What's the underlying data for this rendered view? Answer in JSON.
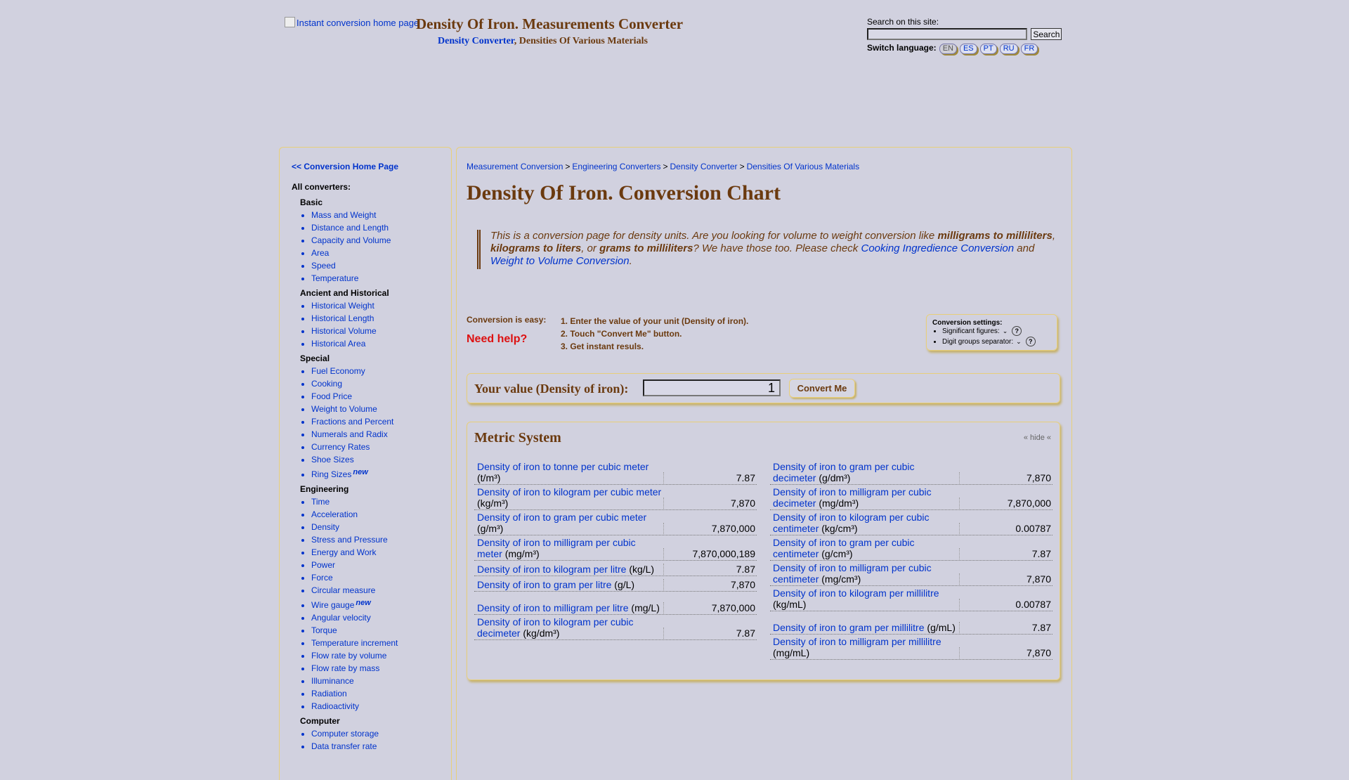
{
  "header": {
    "logo_alt": "Instant conversion home page",
    "title": "Density Of Iron. Measurements Converter",
    "sub_link": "Density Converter",
    "sub_rest": ", Densities Of Various Materials",
    "search_label": "Search on this site:",
    "search_value": "",
    "search_button": "Search",
    "switch_language": "Switch language:",
    "languages": [
      "EN",
      "ES",
      "PT",
      "RU",
      "FR"
    ]
  },
  "sidebar": {
    "home_link": "<< Conversion Home Page",
    "all_converters": "All converters:",
    "categories": [
      {
        "title": "Basic",
        "items": [
          {
            "label": "Mass and Weight"
          },
          {
            "label": "Distance and Length"
          },
          {
            "label": "Capacity and Volume"
          },
          {
            "label": "Area"
          },
          {
            "label": "Speed"
          },
          {
            "label": "Temperature"
          }
        ]
      },
      {
        "title": "Ancient and Historical",
        "items": [
          {
            "label": "Historical Weight"
          },
          {
            "label": "Historical Length"
          },
          {
            "label": "Historical Volume"
          },
          {
            "label": "Historical Area"
          }
        ]
      },
      {
        "title": "Special",
        "items": [
          {
            "label": "Fuel Economy"
          },
          {
            "label": "Cooking"
          },
          {
            "label": "Food Price"
          },
          {
            "label": "Weight to Volume"
          },
          {
            "label": "Fractions and Percent"
          },
          {
            "label": "Numerals and Radix"
          },
          {
            "label": "Currency Rates"
          },
          {
            "label": "Shoe Sizes"
          },
          {
            "label": "Ring Sizes",
            "badge": "new"
          }
        ]
      },
      {
        "title": "Engineering",
        "items": [
          {
            "label": "Time"
          },
          {
            "label": "Acceleration"
          },
          {
            "label": "Density"
          },
          {
            "label": "Stress and Pressure"
          },
          {
            "label": "Energy and Work"
          },
          {
            "label": "Power"
          },
          {
            "label": "Force"
          },
          {
            "label": "Circular measure"
          },
          {
            "label": "Wire gauge",
            "badge": "new"
          },
          {
            "label": "Angular velocity"
          },
          {
            "label": "Torque"
          },
          {
            "label": "Temperature increment"
          },
          {
            "label": "Flow rate by volume"
          },
          {
            "label": "Flow rate by mass"
          },
          {
            "label": "Illuminance"
          },
          {
            "label": "Radiation"
          },
          {
            "label": "Radioactivity"
          }
        ]
      },
      {
        "title": "Computer",
        "items": [
          {
            "label": "Computer storage"
          },
          {
            "label": "Data transfer rate"
          }
        ]
      }
    ]
  },
  "main": {
    "breadcrumb": [
      "Measurement Conversion",
      "Engineering Converters",
      "Density Converter",
      "Densities Of Various Materials"
    ],
    "breadcrumb_sep": ">",
    "title": "Density Of Iron. Conversion Chart",
    "notice": {
      "t1": "This is a conversion page for density units. Are you looking for volume to weight conversion like ",
      "b1": "milligrams to milliliters",
      "t2": ", ",
      "b2": "kilograms to liters",
      "t3": ", or ",
      "b3": "grams to milliliters",
      "t4": "? We have those too. Please check ",
      "l1": "Cooking Ingredience Conversion",
      "t5": " and ",
      "l2": "Weight to Volume Conversion",
      "t6": "."
    },
    "easy_label": "Conversion is easy:",
    "need_help": "Need help?",
    "steps": [
      "1. Enter the value of your unit (Density of iron).",
      "2. Touch \"Convert Me\" button.",
      "3. Get instant resuls."
    ],
    "settings": {
      "title": "Conversion settings:",
      "significant": "Significant figures:",
      "separator": "Digit groups separator:",
      "help": "?"
    },
    "value_label": "Your value (Density of iron):",
    "value": "1",
    "convert_button": "Convert Me",
    "metric": {
      "title": "Metric System",
      "hide": "« hide «",
      "left": [
        {
          "name": "Density of iron to tonne per cubic meter",
          "unit": "(t/m³)",
          "value": "7.87"
        },
        {
          "name": "Density of iron to kilogram per cubic meter",
          "unit": "(kg/m³)",
          "value": "7,870"
        },
        {
          "name": "Density of iron to gram per cubic meter",
          "unit": "(g/m³)",
          "value": "7,870,000"
        },
        {
          "name": "Density of iron to milligram per cubic meter",
          "unit": "(mg/m³)",
          "value": "7,870,000,189"
        },
        {
          "name": "Density of iron to kilogram per litre",
          "unit": "(kg/L)",
          "value": "7.87",
          "single": true
        },
        {
          "name": "Density of iron to gram per litre",
          "unit": "(g/L)",
          "value": "7,870",
          "single": true
        },
        {
          "name": "Density of iron to milligram per litre",
          "unit": "(mg/L)",
          "value": "7,870,000"
        },
        {
          "name": "Density of iron to kilogram per cubic decimeter",
          "unit": "(kg/dm³)",
          "value": "7.87"
        }
      ],
      "right": [
        {
          "name": "Density of iron to gram per cubic decimeter",
          "unit": "(g/dm³)",
          "value": "7,870"
        },
        {
          "name": "Density of iron to milligram per cubic decimeter",
          "unit": "(mg/dm³)",
          "value": "7,870,000"
        },
        {
          "name": "Density of iron to kilogram per cubic centimeter",
          "unit": "(kg/cm³)",
          "value": "0.00787"
        },
        {
          "name": "Density of iron to gram per cubic centimeter",
          "unit": "(g/cm³)",
          "value": "7.87"
        },
        {
          "name": "Density of iron to milligram per cubic centimeter",
          "unit": "(mg/cm³)",
          "value": "7,870"
        },
        {
          "name": "Density of iron to kilogram per millilitre",
          "unit": "(kg/mL)",
          "value": "0.00787"
        },
        {
          "name": "Density of iron to gram per millilitre",
          "unit": "(g/mL)",
          "value": "7.87"
        },
        {
          "name": "Density of iron to milligram per millilitre",
          "unit": "(mg/mL)",
          "value": "7,870"
        }
      ]
    }
  }
}
